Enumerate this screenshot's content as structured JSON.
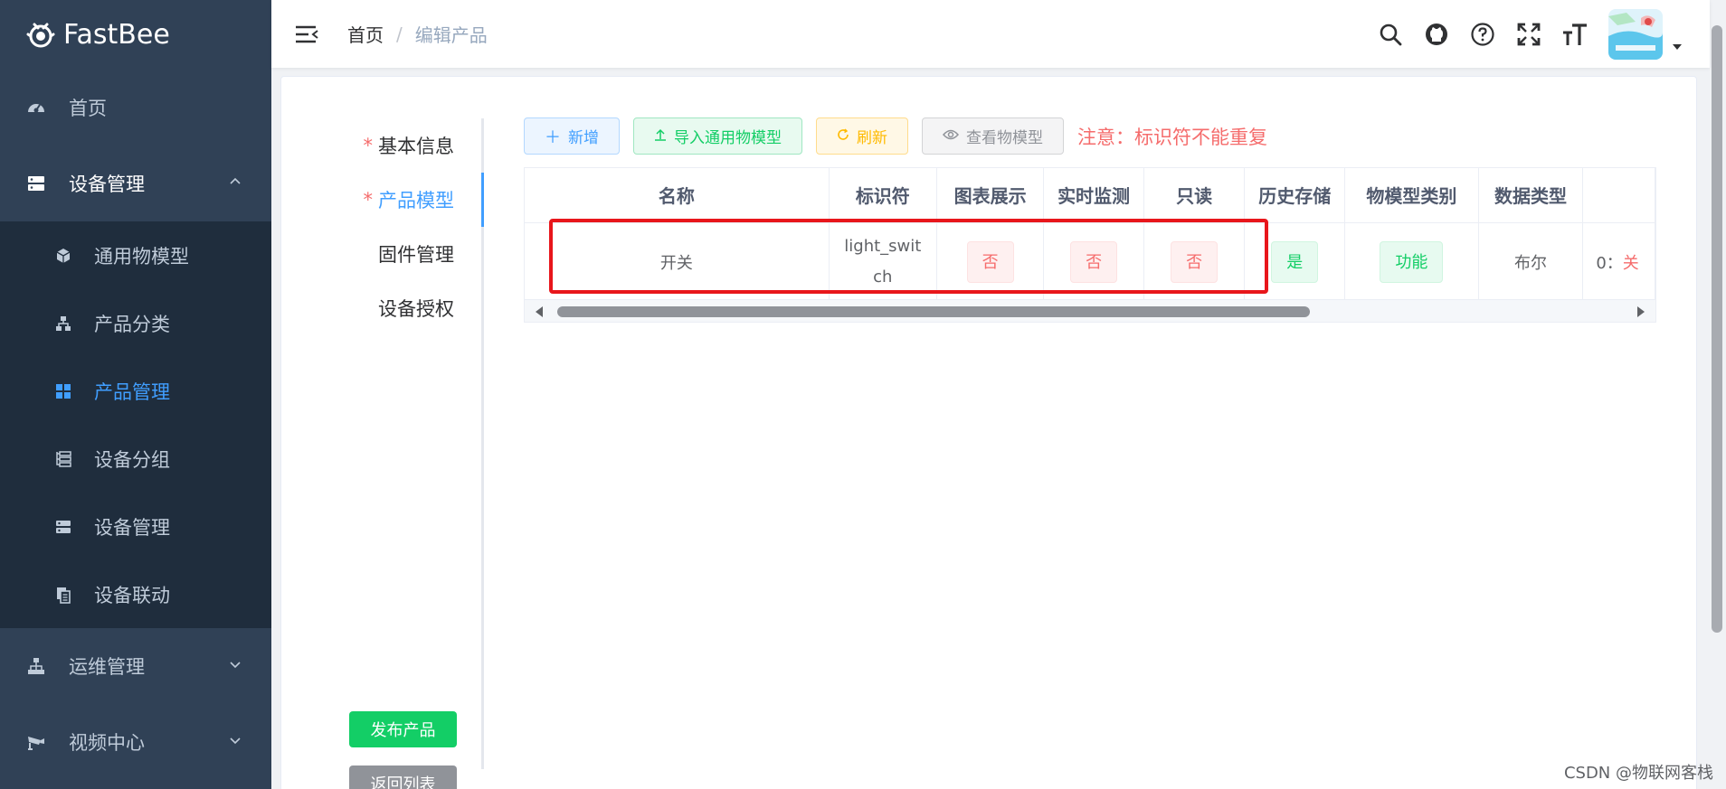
{
  "app": {
    "name": "FastBee"
  },
  "sidebar": {
    "items": [
      {
        "label": "首页",
        "icon": "dashboard-icon"
      },
      {
        "label": "设备管理",
        "icon": "server-icon",
        "expanded": true,
        "children": [
          {
            "label": "通用物模型",
            "icon": "cube-icon"
          },
          {
            "label": "产品分类",
            "icon": "tree-icon"
          },
          {
            "label": "产品管理",
            "icon": "grid-icon",
            "active": true
          },
          {
            "label": "设备分组",
            "icon": "group-icon"
          },
          {
            "label": "设备管理",
            "icon": "server-icon"
          },
          {
            "label": "设备联动",
            "icon": "copy-icon"
          }
        ]
      },
      {
        "label": "运维管理",
        "icon": "tree-icon"
      },
      {
        "label": "视频中心",
        "icon": "camera-icon"
      }
    ]
  },
  "navbar": {
    "breadcrumb": {
      "home": "首页",
      "separator": "/",
      "current": "编辑产品"
    },
    "icons": [
      "search-icon",
      "github-icon",
      "help-icon",
      "fullscreen-icon",
      "font-size-icon"
    ]
  },
  "tabs": {
    "items": [
      {
        "label": "基本信息",
        "required": true
      },
      {
        "label": "产品模型",
        "required": true,
        "active": true
      },
      {
        "label": "固件管理",
        "required": false
      },
      {
        "label": "设备授权",
        "required": false
      }
    ],
    "required_mark": "*",
    "publish_label": "发布产品",
    "back_label": "返回列表"
  },
  "toolbar": {
    "add_label": "新增",
    "import_label": "导入通用物模型",
    "refresh_label": "刷新",
    "view_label": "查看物模型",
    "notice": "注意：标识符不能重复"
  },
  "table": {
    "columns": [
      "名称",
      "标识符",
      "图表展示",
      "实时监测",
      "只读",
      "历史存储",
      "物模型类别",
      "数据类型",
      ""
    ],
    "rows": [
      {
        "name": "开关",
        "identifier": "light_switch",
        "chart": "否",
        "monitor": "否",
        "readonly": "否",
        "history": "是",
        "category": "功能",
        "datatype": "布尔",
        "spec_prefix": "0：",
        "spec_value": "关"
      }
    ]
  },
  "watermark": "CSDN @物联网客栈",
  "colors": {
    "sidebar": "#304156",
    "submenu": "#1f2d3d",
    "primary": "#409eff",
    "danger": "#f56c6c",
    "success": "#13ce66",
    "warning": "#ffba00",
    "highlight": "#e8161b"
  }
}
